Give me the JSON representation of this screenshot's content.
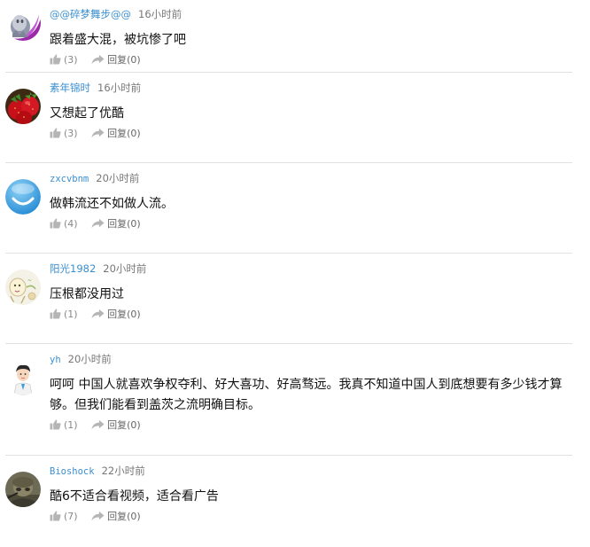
{
  "comments": [
    {
      "username": "@@碎梦舞步@@",
      "time": "16小时前",
      "text": "跟着盛大混，被坑惨了吧",
      "likes": "(3)",
      "reply_label": "回复",
      "reply_count": "(0)",
      "avatar_icon": "ghost-on-purple-avatar"
    },
    {
      "username": "素年锦时",
      "time": "16小时前",
      "text": "又想起了优酷",
      "likes": "(3)",
      "reply_label": "回复",
      "reply_count": "(0)",
      "avatar_icon": "strawberries-avatar"
    },
    {
      "username": "zxcvbnm",
      "time": "20小时前",
      "text": "做韩流还不如做人流。",
      "likes": "(4)",
      "reply_label": "回复",
      "reply_count": "(0)",
      "avatar_icon": "blue-smiley-avatar"
    },
    {
      "username": "阳光1982",
      "time": "20小时前",
      "text": "压根都没用过",
      "likes": "(1)",
      "reply_label": "回复",
      "reply_count": "(0)",
      "avatar_icon": "cartoon-doodle-avatar"
    },
    {
      "username": "yh",
      "time": "20小时前",
      "text": "呵呵 中国人就喜欢争权夺利、好大喜功、好高骛远。我真不知道中国人到底想要有多少钱才算够。但我们能看到盖茨之流明确目标。",
      "likes": "(1)",
      "reply_label": "回复",
      "reply_count": "(0)",
      "avatar_icon": "cartoon-person-avatar"
    },
    {
      "username": "Bioshock",
      "time": "22小时前",
      "text": "酷6不适合看视频，适合看广告",
      "likes": "(7)",
      "reply_label": "回复",
      "reply_count": "(0)",
      "avatar_icon": "soldier-avatar"
    }
  ],
  "colors": {
    "username": "#3a8fd0",
    "divider": "#e1e1e1",
    "icon": "#b8b8b8"
  }
}
